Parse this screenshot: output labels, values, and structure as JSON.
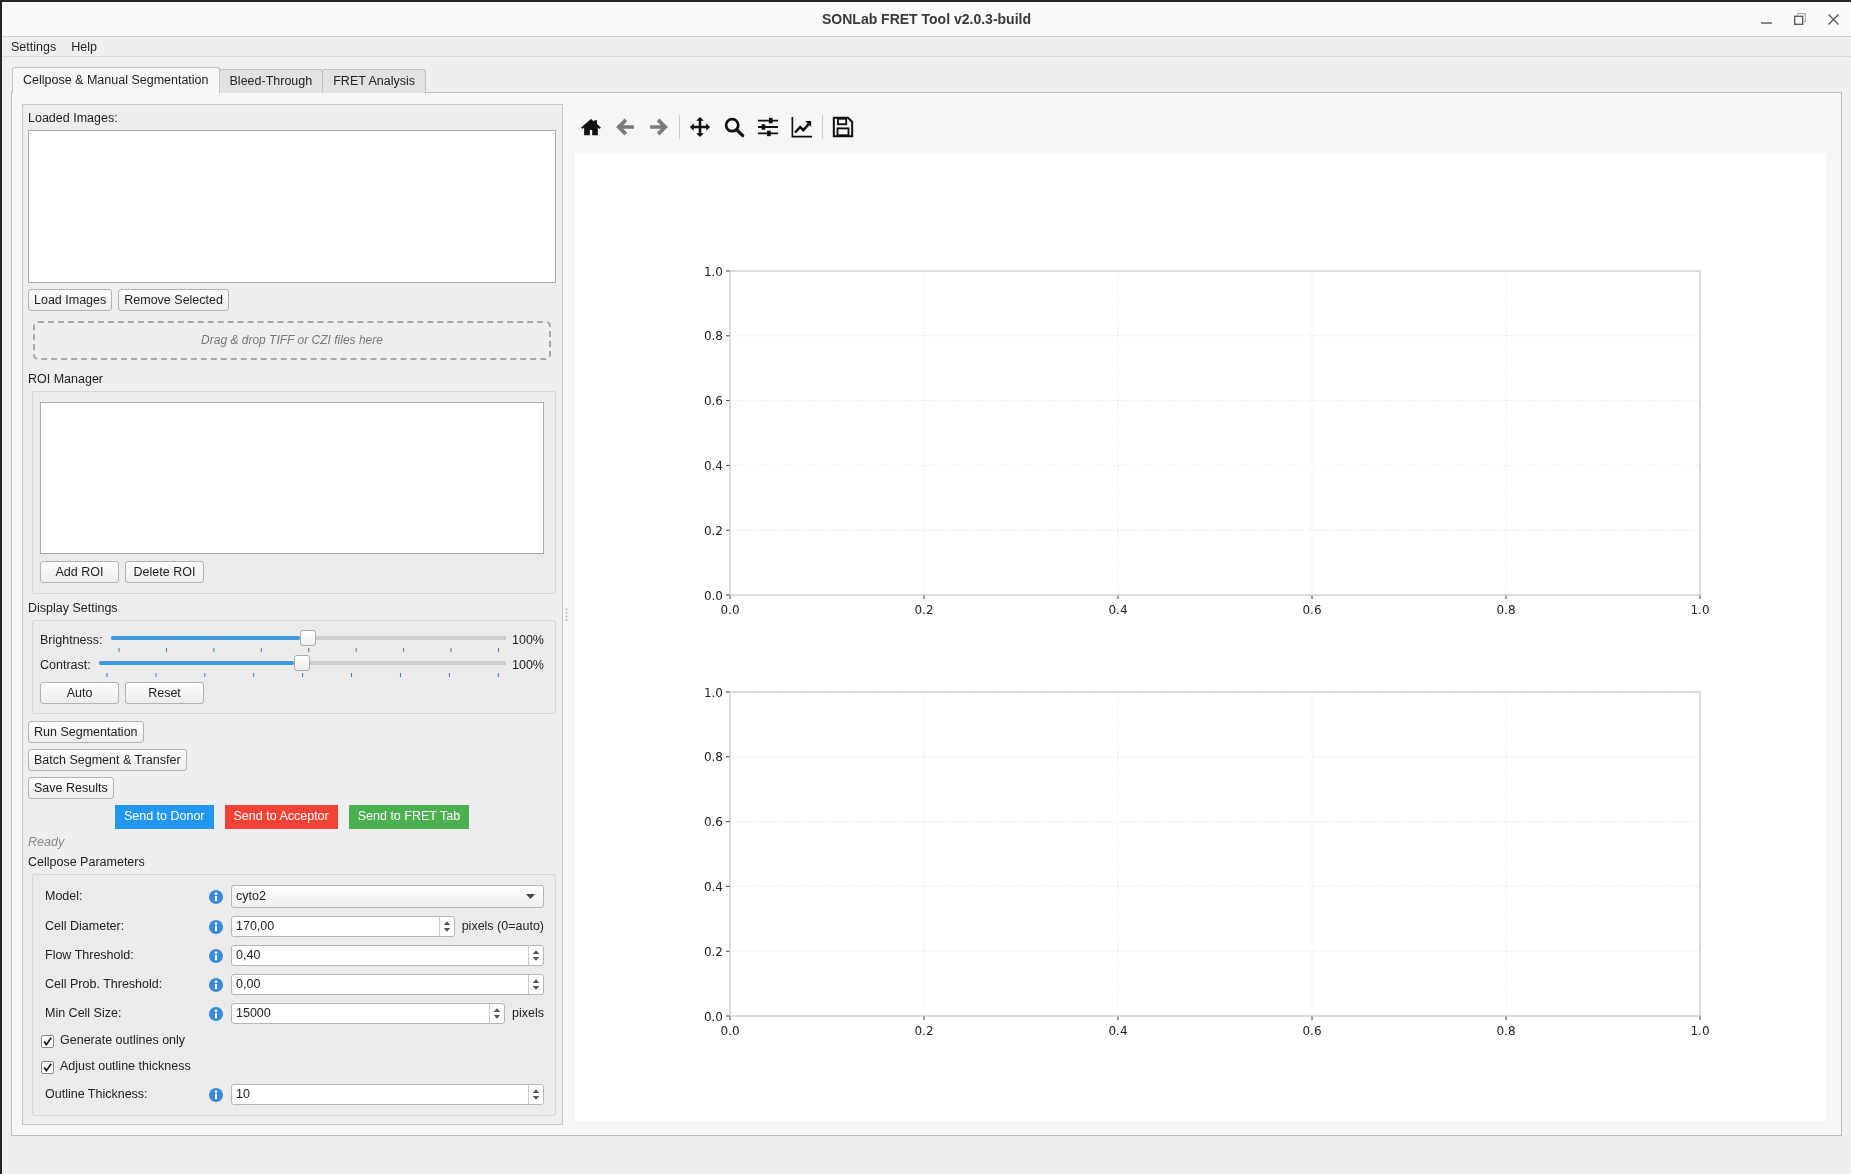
{
  "window": {
    "title": "SONLab FRET Tool v2.0.3-build"
  },
  "menu": [
    "Settings",
    "Help"
  ],
  "tabs": [
    {
      "label": "Cellpose & Manual Segmentation",
      "selected": true
    },
    {
      "label": "Bleed-Through",
      "selected": false
    },
    {
      "label": "FRET Analysis",
      "selected": false
    }
  ],
  "loaded_images": {
    "label": "Loaded Images:",
    "buttons": [
      "Load Images",
      "Remove Selected"
    ],
    "drop_hint": "Drag & drop TIFF or CZI files here"
  },
  "roi_manager": {
    "title": "ROI Manager",
    "buttons": [
      "Add ROI",
      "Delete ROI"
    ]
  },
  "display_settings": {
    "title": "Display Settings",
    "sliders": [
      {
        "label": "Brightness:",
        "level": 0.5,
        "reading": "100%"
      },
      {
        "label": "Contrast:",
        "level": 0.5,
        "reading": "100%"
      }
    ],
    "buttons": [
      "Auto",
      "Reset"
    ]
  },
  "actions": [
    "Run Segmentation",
    "Batch Segment & Transfer",
    "Save Results"
  ],
  "send_buttons": [
    {
      "label": "Send to Donor",
      "color": "#2196f3"
    },
    {
      "label": "Send to Acceptor",
      "color": "#f44336"
    },
    {
      "label": "Send to FRET Tab",
      "color": "#4caf50"
    }
  ],
  "status": "Ready",
  "cellpose_parameters": {
    "title": "Cellpose Parameters",
    "rows": [
      {
        "kind": "dropdown",
        "label": "Model:",
        "value": "cyto2"
      },
      {
        "kind": "spin",
        "label": "Cell Diameter:",
        "value": "170,00",
        "unit": "pixels (0=auto)"
      },
      {
        "kind": "spin",
        "label": "Flow Threshold:",
        "value": "0,40"
      },
      {
        "kind": "spin",
        "label": "Cell Prob. Threshold:",
        "value": "0,00"
      },
      {
        "kind": "spin",
        "label": "Min Cell Size:",
        "value": "15000",
        "unit": "pixels"
      },
      {
        "kind": "checkbox",
        "label": "Generate outlines only",
        "checked": true
      },
      {
        "kind": "checkbox",
        "label": "Adjust outline thickness",
        "checked": true
      },
      {
        "kind": "spin",
        "label": "Outline Thickness:",
        "value": "10"
      }
    ]
  },
  "plot_panel": {
    "toolbar": [
      {
        "disabled": false
      },
      {
        "disabled": true
      },
      {
        "disabled": true
      },
      {
        "disabled": false
      },
      {
        "disabled": false
      },
      {
        "disabled": false
      },
      {
        "disabled": false
      },
      {
        "disabled": false
      }
    ],
    "plots": [
      {
        "chart_data": {
          "type": "line",
          "grid": true,
          "xlim": [
            0,
            1
          ],
          "ylim": [
            0,
            1
          ],
          "xticks": [
            {
              "value": 0,
              "label": "0.0"
            },
            {
              "value": 0.2,
              "label": "0.2"
            },
            {
              "value": 0.4,
              "label": "0.4"
            },
            {
              "value": 0.6,
              "label": "0.6"
            },
            {
              "value": 0.8,
              "label": "0.8"
            },
            {
              "value": 1,
              "label": "1.0"
            }
          ],
          "yticks": [
            {
              "value": 0,
              "label": "0.0"
            },
            {
              "value": 0.2,
              "label": "0.2"
            },
            {
              "value": 0.4,
              "label": "0.4"
            },
            {
              "value": 0.6,
              "label": "0.6"
            },
            {
              "value": 0.8,
              "label": "0.8"
            },
            {
              "value": 1,
              "label": "1.0"
            }
          ]
        }
      },
      {
        "chart_data": {
          "type": "line",
          "grid": true,
          "xlim": [
            0,
            1
          ],
          "ylim": [
            0,
            1
          ],
          "xticks": [
            {
              "value": 0,
              "label": "0.0"
            },
            {
              "value": 0.2,
              "label": "0.2"
            },
            {
              "value": 0.4,
              "label": "0.4"
            },
            {
              "value": 0.6,
              "label": "0.6"
            },
            {
              "value": 0.8,
              "label": "0.8"
            },
            {
              "value": 1,
              "label": "1.0"
            }
          ],
          "yticks": [
            {
              "value": 0,
              "label": "0.0"
            },
            {
              "value": 0.2,
              "label": "0.2"
            },
            {
              "value": 0.4,
              "label": "0.4"
            },
            {
              "value": 0.6,
              "label": "0.6"
            },
            {
              "value": 0.8,
              "label": "0.8"
            },
            {
              "value": 1,
              "label": "1.0"
            }
          ]
        }
      }
    ]
  }
}
